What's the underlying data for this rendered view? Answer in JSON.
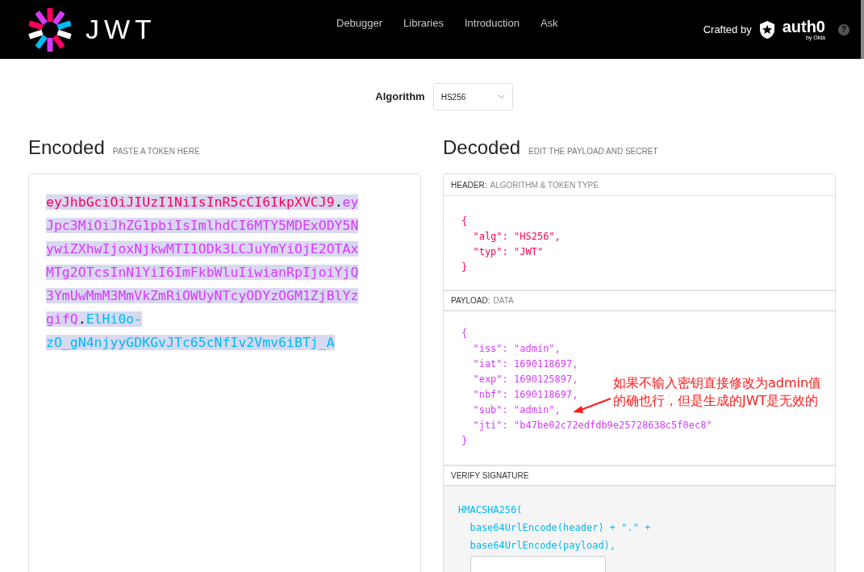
{
  "nav": {
    "brand": "JWT",
    "links": [
      "Debugger",
      "Libraries",
      "Introduction",
      "Ask"
    ],
    "crafted_by": "Crafted by",
    "partner": "auth0",
    "partner_sub": "by Okta",
    "help": "?"
  },
  "algorithm": {
    "label": "Algorithm",
    "value": "HS256"
  },
  "encoded": {
    "title": "Encoded",
    "subtitle": "PASTE A TOKEN HERE",
    "lines": [
      [
        {
          "text": "eyJhbGciOiJIUzI1NiIsInR5cCI6IkpXVCJ9",
          "kind": "header"
        },
        {
          "text": ".",
          "kind": "dot"
        },
        {
          "text": "ey",
          "kind": "payload"
        }
      ],
      [
        {
          "text": "Jpc3MiOiJhZG1pbiIsImlhdCI6MTY5MDExODY5N",
          "kind": "payload"
        }
      ],
      [
        {
          "text": "ywiZXhwIjoxNjkwMTI1ODk3LCJuYmYiOjE2OTAx",
          "kind": "payload"
        }
      ],
      [
        {
          "text": "MTg2OTcsInN1YiI6ImFkbWluIiwianRpIjoiYjQ",
          "kind": "payload"
        }
      ],
      [
        {
          "text": "3YmUwMmM3MmVkZmRiOWUyNTcyODYzOGM1ZjBlYz",
          "kind": "payload"
        }
      ],
      [
        {
          "text": "gifQ",
          "kind": "payload"
        },
        {
          "text": ".",
          "kind": "dot"
        },
        {
          "text": "ElHi0o-",
          "kind": "signature"
        }
      ],
      [
        {
          "text": "zO_gN4njyyGDKGvJTc65cNfIv2Vmv6iBTj_A",
          "kind": "signature"
        }
      ]
    ]
  },
  "decoded": {
    "title": "Decoded",
    "subtitle": "EDIT THE PAYLOAD AND SECRET",
    "header": {
      "label": "HEADER:",
      "sublabel": "ALGORITHM & TOKEN TYPE",
      "lines": [
        "{",
        "  \"alg\": \"HS256\",",
        "  \"typ\": \"JWT\"",
        "}"
      ]
    },
    "payload": {
      "label": "PAYLOAD:",
      "sublabel": "DATA",
      "lines": [
        "{",
        "  \"iss\": \"admin\",",
        "  \"iat\": 1690118697,",
        "  \"exp\": 1690125897,",
        "  \"nbf\": 1690118697,",
        "  \"sub\": \"admin\",",
        "  \"jti\": \"b47be02c72edfdb9e25728638c5f0ec8\"",
        "}"
      ],
      "annotation": [
        "如果不输入密钥直接修改为admin值",
        "的确也行，但是生成的JWT是无效的"
      ]
    },
    "signature": {
      "label": "VERIFY SIGNATURE",
      "lines": [
        "HMACSHA256(",
        "  base64UrlEncode(header) + \".\" +",
        "  base64UrlEncode(payload),"
      ]
    }
  }
}
